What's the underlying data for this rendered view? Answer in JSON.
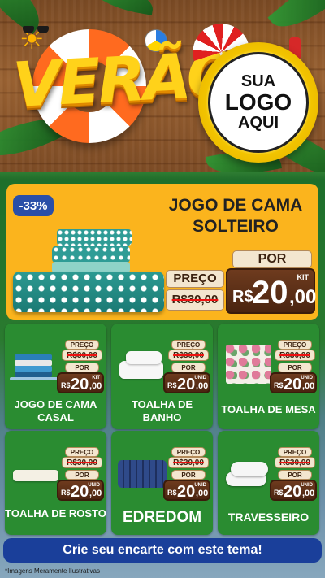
{
  "header": {
    "title": "VERÃO",
    "logo_line1": "SUA",
    "logo_line2": "LOGO",
    "logo_line3": "AQUI"
  },
  "featured": {
    "discount": "-33%",
    "title": "JOGO DE CAMA SOLTEIRO",
    "price_label": "PREÇO",
    "old_price": "R$30,00",
    "por_label": "POR",
    "currency": "R$",
    "new_int": "20",
    "new_cents": ",00",
    "unit": "KIT"
  },
  "products": [
    {
      "name": "JOGO DE CAMA CASAL",
      "price_label": "PREÇO",
      "old_price": "R$30,00",
      "por_label": "POR",
      "currency": "R$",
      "new_int": "20",
      "new_cents": ",00",
      "unit": "KIT",
      "icon": "bed-sheets-icon"
    },
    {
      "name": "TOALHA DE BANHO",
      "price_label": "PREÇO",
      "old_price": "R$30,00",
      "por_label": "POR",
      "currency": "R$",
      "new_int": "20",
      "new_cents": ",00",
      "unit": "UNID",
      "icon": "bath-towel-icon"
    },
    {
      "name": "TOALHA DE MESA",
      "price_label": "PREÇO",
      "old_price": "R$30,00",
      "por_label": "POR",
      "currency": "R$",
      "new_int": "20",
      "new_cents": ",00",
      "unit": "UNID",
      "icon": "tablecloth-icon"
    },
    {
      "name": "TOALHA DE ROSTO",
      "price_label": "PREÇO",
      "old_price": "R$30,00",
      "por_label": "POR",
      "currency": "R$",
      "new_int": "20",
      "new_cents": ",00",
      "unit": "UNID",
      "icon": "face-towel-icon"
    },
    {
      "name": "EDREDOM",
      "price_label": "PREÇO",
      "old_price": "R$30,00",
      "por_label": "POR",
      "currency": "R$",
      "new_int": "20",
      "new_cents": ",00",
      "unit": "UNID",
      "icon": "duvet-icon"
    },
    {
      "name": "TRAVESSEIRO",
      "price_label": "PREÇO",
      "old_price": "R$30,00",
      "por_label": "POR",
      "currency": "R$",
      "new_int": "20",
      "new_cents": ",00",
      "unit": "UNID",
      "icon": "pillow-icon"
    }
  ],
  "cta": {
    "label": "Crie seu encarte com este tema!"
  },
  "footnote": "*Imagens Meramente Ilustrativas",
  "colors": {
    "header_wood": "#9a6232",
    "featured_bg": "#fbb41d",
    "card_bg": "#2a8c31",
    "discount_badge": "#2a4fa8",
    "price_wood": "#4a2410",
    "cta_bg": "#1a3f9a",
    "title_yellow": "#ffd21a"
  }
}
